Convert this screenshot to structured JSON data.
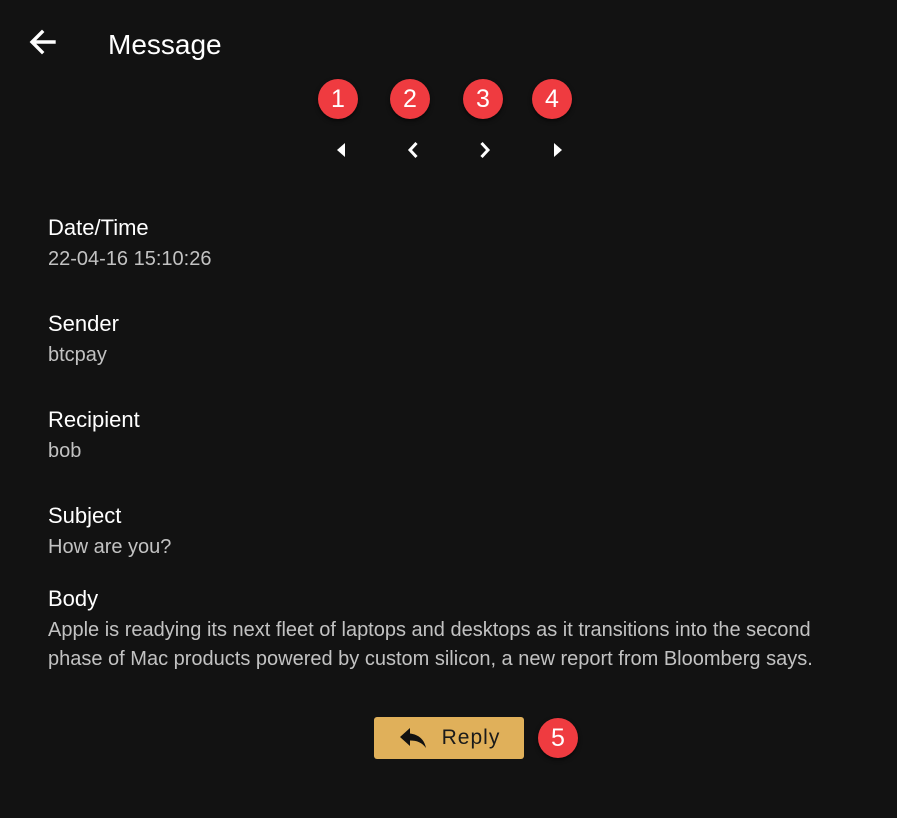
{
  "header": {
    "title": "Message",
    "back_icon": "arrow-left-icon"
  },
  "annotations": {
    "badge_color": "#ef3b40",
    "markers": [
      "1",
      "2",
      "3",
      "4",
      "5"
    ]
  },
  "navigation": {
    "first_icon": "triangle-left-icon",
    "prev_icon": "chevron-left-icon",
    "next_icon": "chevron-right-icon",
    "last_icon": "triangle-right-icon"
  },
  "fields": {
    "datetime": {
      "label": "Date/Time",
      "value": "22-04-16 15:10:26"
    },
    "sender": {
      "label": "Sender",
      "value": "btcpay"
    },
    "recipient": {
      "label": "Recipient",
      "value": "bob"
    },
    "subject": {
      "label": "Subject",
      "value": "How are you?"
    },
    "body": {
      "label": "Body",
      "value": "Apple is readying its next fleet of laptops and desktops as it transitions into the second phase of Mac products powered by custom silicon, a new report from Bloomberg says."
    }
  },
  "actions": {
    "reply_label": "Reply",
    "reply_icon": "reply-icon",
    "reply_color": "#e0b05a"
  },
  "colors": {
    "background": "#121212",
    "label": "#ffffff",
    "value": "#c2c2c2"
  }
}
